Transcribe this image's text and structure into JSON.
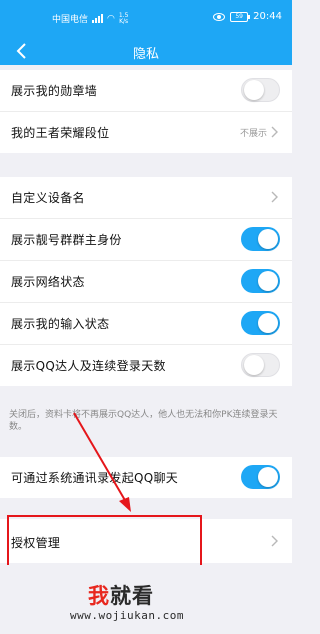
{
  "status_bar": {
    "carrier": "中国电信",
    "network": "4G",
    "speed_value": "1.5",
    "speed_unit": "K/s",
    "battery": "59",
    "time": "20:44"
  },
  "nav": {
    "title": "隐私"
  },
  "group1": [
    {
      "label": "展示我的勋章墙",
      "control": "toggle",
      "on": false
    },
    {
      "label": "我的王者荣耀段位",
      "control": "link",
      "value": "不展示"
    }
  ],
  "group2": [
    {
      "label": "自定义设备名",
      "control": "link"
    },
    {
      "label": "展示靓号群群主身份",
      "control": "toggle",
      "on": true
    },
    {
      "label": "展示网络状态",
      "control": "toggle",
      "on": true
    },
    {
      "label": "展示我的输入状态",
      "control": "toggle",
      "on": true
    },
    {
      "label": "展示QQ达人及连续登录天数",
      "control": "toggle",
      "on": false
    }
  ],
  "note": "关闭后，资料卡将不再展示QQ达人，他人也无法和你PK连续登录天数。",
  "group3": [
    {
      "label": "可通过系统通讯录发起QQ聊天",
      "control": "toggle",
      "on": true
    }
  ],
  "group4": [
    {
      "label": "授权管理",
      "control": "link"
    }
  ],
  "watermark": {
    "text_a": "我",
    "text_b": "就看",
    "url": "www.wojiukan.com"
  },
  "colors": {
    "accent": "#1ea7f5",
    "annotation": "#e5161b"
  }
}
